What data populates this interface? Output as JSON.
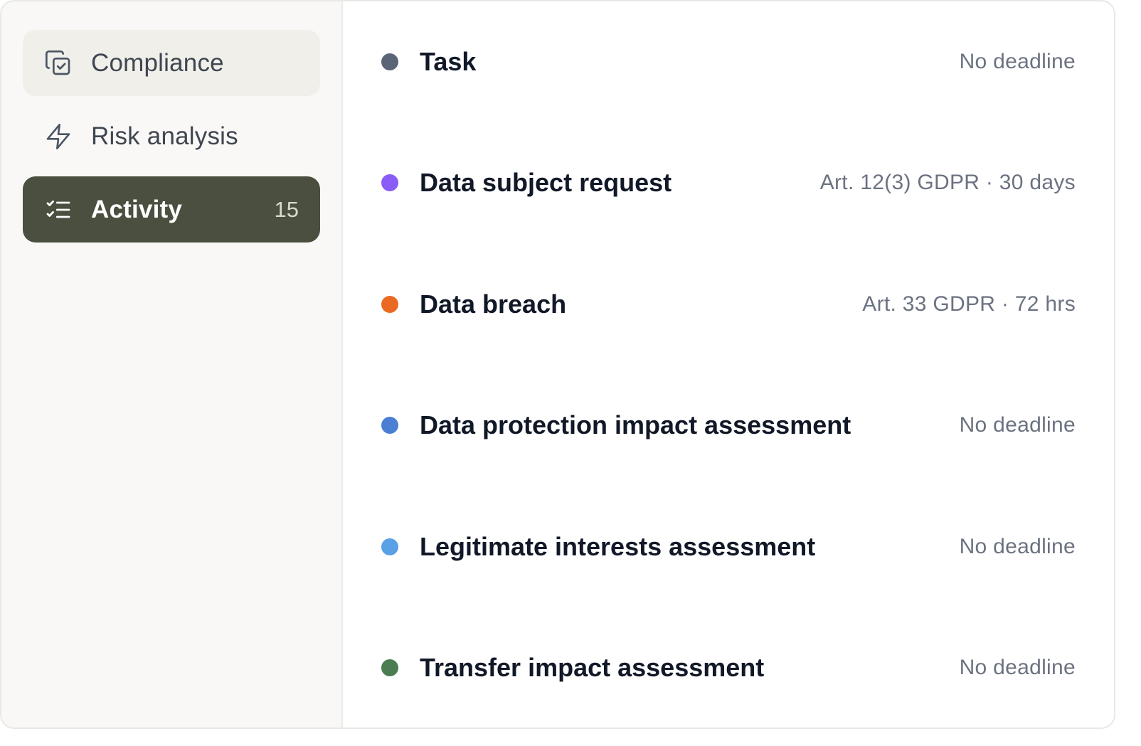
{
  "sidebar": {
    "items": [
      {
        "label": "Compliance",
        "icon": "copy-check-icon",
        "count": ""
      },
      {
        "label": "Risk analysis",
        "icon": "lightning-icon",
        "count": ""
      },
      {
        "label": "Activity",
        "icon": "checklist-icon",
        "count": "15"
      }
    ]
  },
  "activities": [
    {
      "title": "Task",
      "meta": "No deadline",
      "color": "#5b6577"
    },
    {
      "title": "Data subject request",
      "meta": "Art. 12(3) GDPR · 30 days",
      "color": "#8b5cf6"
    },
    {
      "title": "Data breach",
      "meta": "Art. 33 GDPR · 72 hrs",
      "color": "#ea6a23"
    },
    {
      "title": "Data protection impact assessment",
      "meta": "No deadline",
      "color": "#4a7fd4"
    },
    {
      "title": "Legitimate interests assessment",
      "meta": "No deadline",
      "color": "#5aa0e6"
    },
    {
      "title": "Transfer impact assessment",
      "meta": "No deadline",
      "color": "#4a7d52"
    }
  ],
  "colors": {
    "active_nav_bg": "#4a4f3f",
    "hover_nav_bg": "#f0efea",
    "sidebar_bg": "#f9f8f6"
  }
}
